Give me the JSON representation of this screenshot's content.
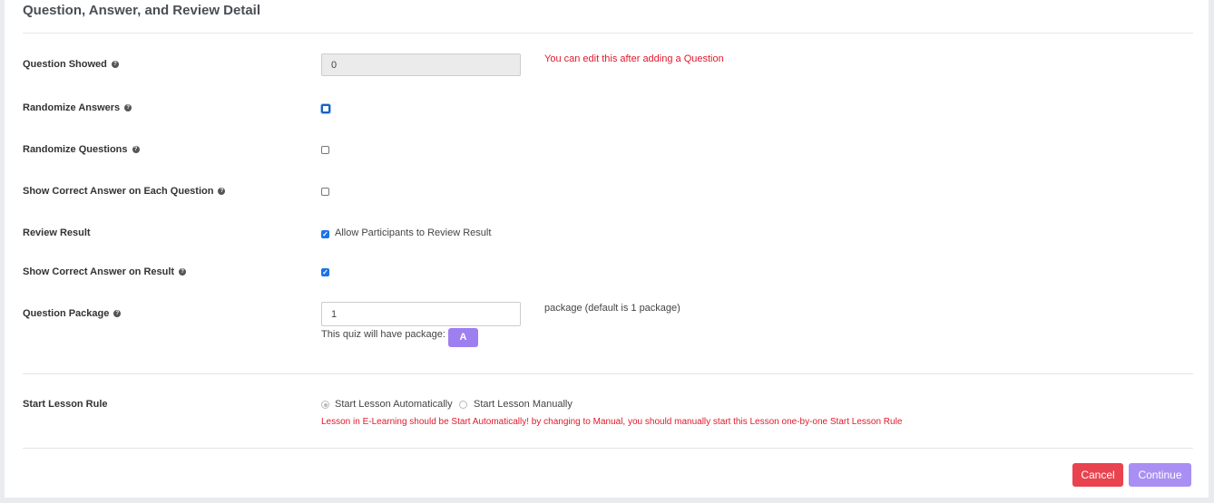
{
  "section": {
    "title": "Question, Answer, and Review Detail"
  },
  "question_showed": {
    "label": "Question Showed",
    "value": "0",
    "note": "You can edit this after adding a Question"
  },
  "randomize_answers": {
    "label": "Randomize Answers"
  },
  "randomize_questions": {
    "label": "Randomize Questions"
  },
  "show_correct_each": {
    "label": "Show Correct Answer on Each Question"
  },
  "review_result": {
    "label": "Review Result",
    "checkbox_label": "Allow Participants to Review Result"
  },
  "show_correct_result": {
    "label": "Show Correct Answer on Result"
  },
  "question_package": {
    "label": "Question Package",
    "value": "1",
    "hint": "package (default is 1 package)",
    "package_text": "This quiz will have package:",
    "badge": "A"
  },
  "start_lesson": {
    "label": "Start Lesson Rule",
    "option_auto": "Start Lesson Automatically",
    "option_manual": "Start Lesson Manually",
    "warning": "Lesson in E-Learning should be Start Automatically! by changing to Manual, you should manually start this Lesson one-by-one Start Lesson Rule"
  },
  "buttons": {
    "cancel": "Cancel",
    "continue": "Continue"
  },
  "colors": {
    "danger": "#e8434f",
    "primary": "#a98ff3",
    "accent": "#1a73e8"
  }
}
